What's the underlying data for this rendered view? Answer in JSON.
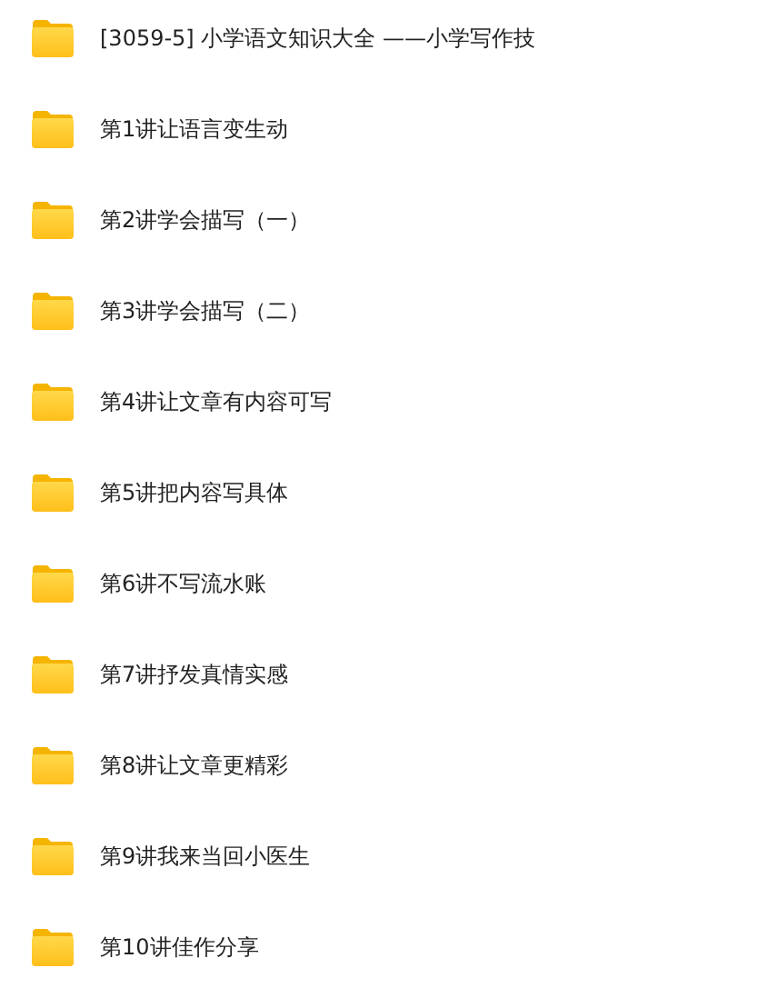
{
  "items": [
    {
      "name": "[3059-5] 小学语文知识大全 ——小学写作技"
    },
    {
      "name": "第1讲让语言变生动"
    },
    {
      "name": "第2讲学会描写（一）"
    },
    {
      "name": "第3讲学会描写（二）"
    },
    {
      "name": "第4讲让文章有内容可写"
    },
    {
      "name": "第5讲把内容写具体"
    },
    {
      "name": "第6讲不写流水账"
    },
    {
      "name": "第7讲抒发真情实感"
    },
    {
      "name": "第8讲让文章更精彩"
    },
    {
      "name": "第9讲我来当回小医生"
    },
    {
      "name": "第10讲佳作分享"
    }
  ]
}
